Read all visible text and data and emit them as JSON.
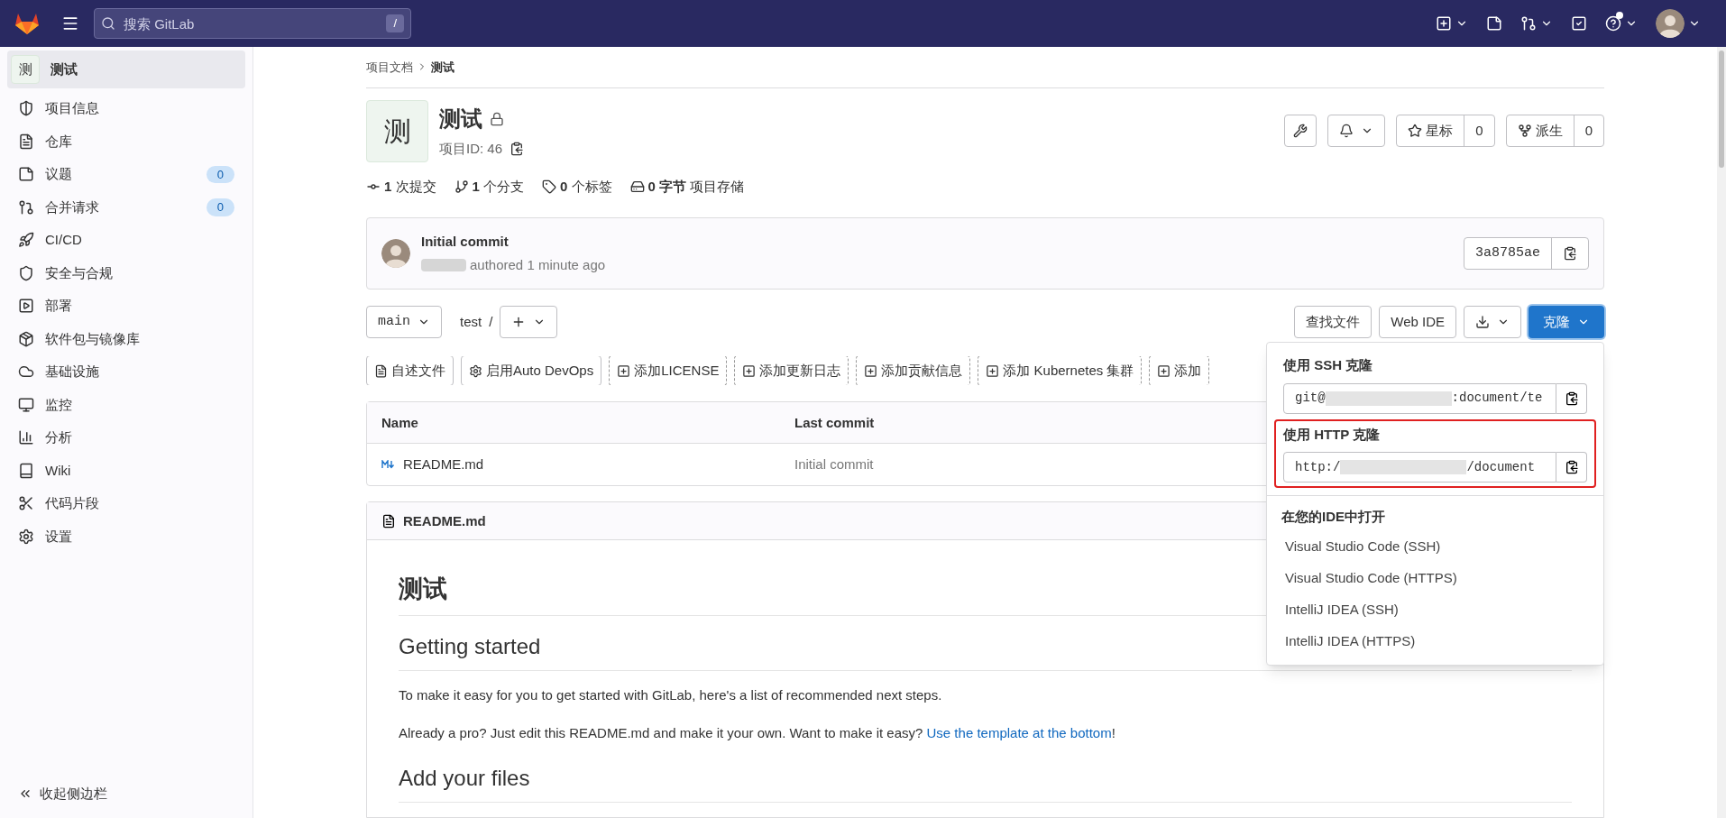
{
  "top_bar": {
    "search": {
      "placeholder": "搜索 GitLab",
      "shortcut": "/"
    },
    "help_notification": true
  },
  "sidebar": {
    "project": {
      "avatar": "测",
      "name": "测试",
      "selected": true
    },
    "items": [
      {
        "label": "项目信息"
      },
      {
        "label": "仓库"
      },
      {
        "label": "议题",
        "count": "0"
      },
      {
        "label": "合并请求",
        "count": "0"
      },
      {
        "label": "CI/CD"
      },
      {
        "label": "安全与合规"
      },
      {
        "label": "部署"
      },
      {
        "label": "软件包与镜像库"
      },
      {
        "label": "基础设施"
      },
      {
        "label": "监控"
      },
      {
        "label": "分析"
      },
      {
        "label": "Wiki"
      },
      {
        "label": "代码片段"
      },
      {
        "label": "设置"
      }
    ],
    "collapse": "收起侧边栏"
  },
  "breadcrumb": [
    "项目文档",
    "测试"
  ],
  "project": {
    "avatar": "测",
    "title": "测试",
    "id_label": "项目ID: 46",
    "star_label": "星标",
    "star_count": "0",
    "fork_label": "派生",
    "fork_count": "0"
  },
  "stats": [
    {
      "value": "1",
      "label": "次提交"
    },
    {
      "value": "1",
      "label": "个分支"
    },
    {
      "value": "0",
      "label": "个标签"
    },
    {
      "value": "0 字节",
      "label": "项目存储"
    }
  ],
  "last_commit": {
    "title": "Initial commit",
    "meta": "authored 1 minute ago",
    "sha": "3a8785ae"
  },
  "branch": {
    "name": "main",
    "path": "test",
    "separator": "/"
  },
  "repo_buttons": [
    "查找文件",
    "Web IDE"
  ],
  "clone_button": "克隆",
  "quick_actions": [
    {
      "label": "自述文件",
      "kind": "file"
    },
    {
      "label": "启用Auto DevOps",
      "kind": "gear"
    },
    {
      "label": "添加LICENSE",
      "kind": "add"
    },
    {
      "label": "添加更新日志",
      "kind": "add"
    },
    {
      "label": "添加贡献信息",
      "kind": "add"
    },
    {
      "label": "添加 Kubernetes 集群",
      "kind": "add"
    },
    {
      "label": "添加",
      "kind": "add"
    }
  ],
  "file_table": {
    "columns": [
      "Name",
      "Last commit"
    ],
    "rows": [
      {
        "name": "README.md",
        "last_commit": "Initial commit"
      }
    ]
  },
  "readme": {
    "filename": "README.md",
    "blocks": [
      {
        "kind": "h1",
        "text": "测试"
      },
      {
        "kind": "h2",
        "text": "Getting started"
      },
      {
        "kind": "p",
        "text": "To make it easy for you to get started with GitLab, here's a list of recommended next steps."
      },
      {
        "kind": "p",
        "text": "Already a pro? Just edit this README.md and make it your own. Want to make it easy? ",
        "link": "Use the template at the bottom",
        "after": "!"
      },
      {
        "kind": "h2",
        "text": "Add your files"
      }
    ]
  },
  "clone_menu": {
    "sections": [
      {
        "label": "使用 SSH 克隆",
        "prefix": "git@",
        "suffix": ":document/te",
        "highlighted": false
      },
      {
        "label": "使用 HTTP 克隆",
        "prefix": "http:/",
        "suffix": "/document",
        "highlighted": true
      }
    ],
    "ide_title": "在您的IDE中打开",
    "ide_items": [
      "Visual Studio Code (SSH)",
      "Visual Studio Code (HTTPS)",
      "IntelliJ IDEA (SSH)",
      "IntelliJ IDEA (HTTPS)"
    ]
  }
}
